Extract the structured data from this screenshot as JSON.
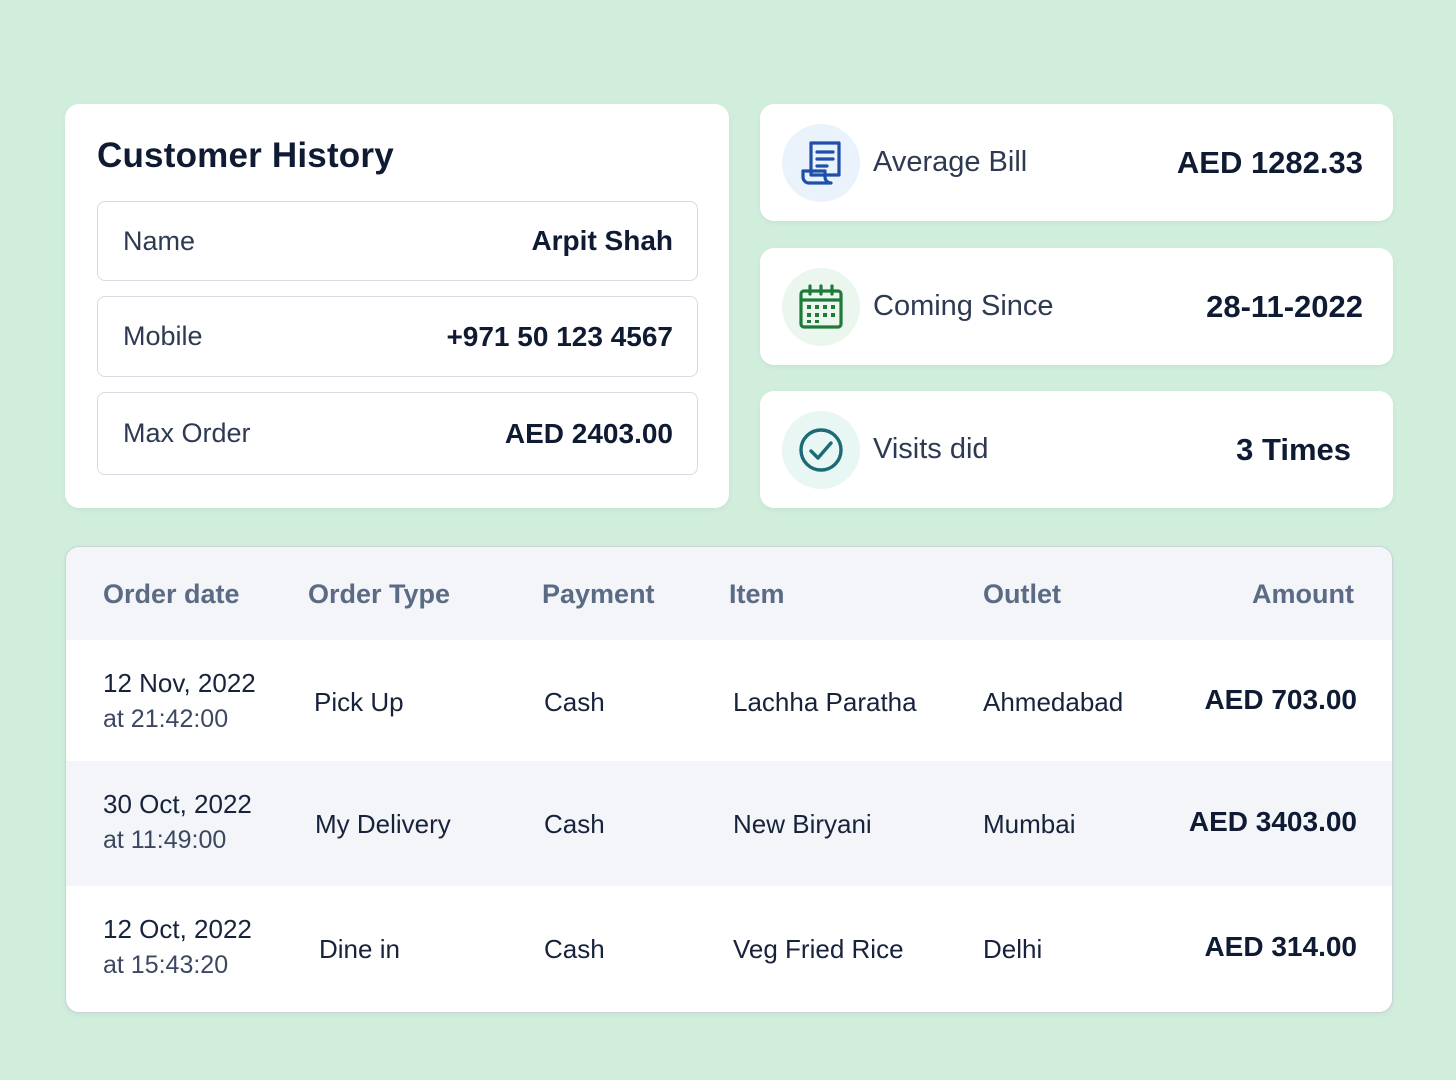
{
  "history": {
    "title": "Customer History",
    "fields": [
      {
        "label": "Name",
        "value": "Arpit Shah"
      },
      {
        "label": "Mobile",
        "value": "+971 50 123 4567"
      },
      {
        "label": "Max Order",
        "value": "AED 2403.00"
      }
    ]
  },
  "stats": [
    {
      "label": "Average Bill",
      "value": "AED 1282.33",
      "icon": "receipt-icon",
      "color": "#1f4fa8"
    },
    {
      "label": "Coming Since",
      "value": "28-11-2022",
      "icon": "calendar-icon",
      "color": "#1f7a3a"
    },
    {
      "label": "Visits did",
      "value": "3 Times",
      "icon": "check-circle-icon",
      "color": "#1a6b74"
    }
  ],
  "table": {
    "columns": [
      "Order date",
      "Order Type",
      "Payment",
      "Item",
      "Outlet",
      "Amount"
    ],
    "rows": [
      {
        "date": "12 Nov, 2022",
        "time": "at 21:42:00",
        "type": "Pick Up",
        "payment": "Cash",
        "item": "Lachha Paratha",
        "outlet": "Ahmedabad",
        "amount": "AED 703.00"
      },
      {
        "date": "30 Oct, 2022",
        "time": "at 11:49:00",
        "type": "My Delivery",
        "payment": "Cash",
        "item": "New Biryani",
        "outlet": "Mumbai",
        "amount": "AED 3403.00"
      },
      {
        "date": "12 Oct, 2022",
        "time": "at 15:43:20",
        "type": "Dine in",
        "payment": "Cash",
        "item": "Veg Fried Rice",
        "outlet": "Delhi",
        "amount": "AED 314.00"
      }
    ]
  },
  "colors": {
    "background": "#d1eedd",
    "card": "#ffffff",
    "header_text": "#5b6b85",
    "alt_row": "#f3f5f8"
  }
}
